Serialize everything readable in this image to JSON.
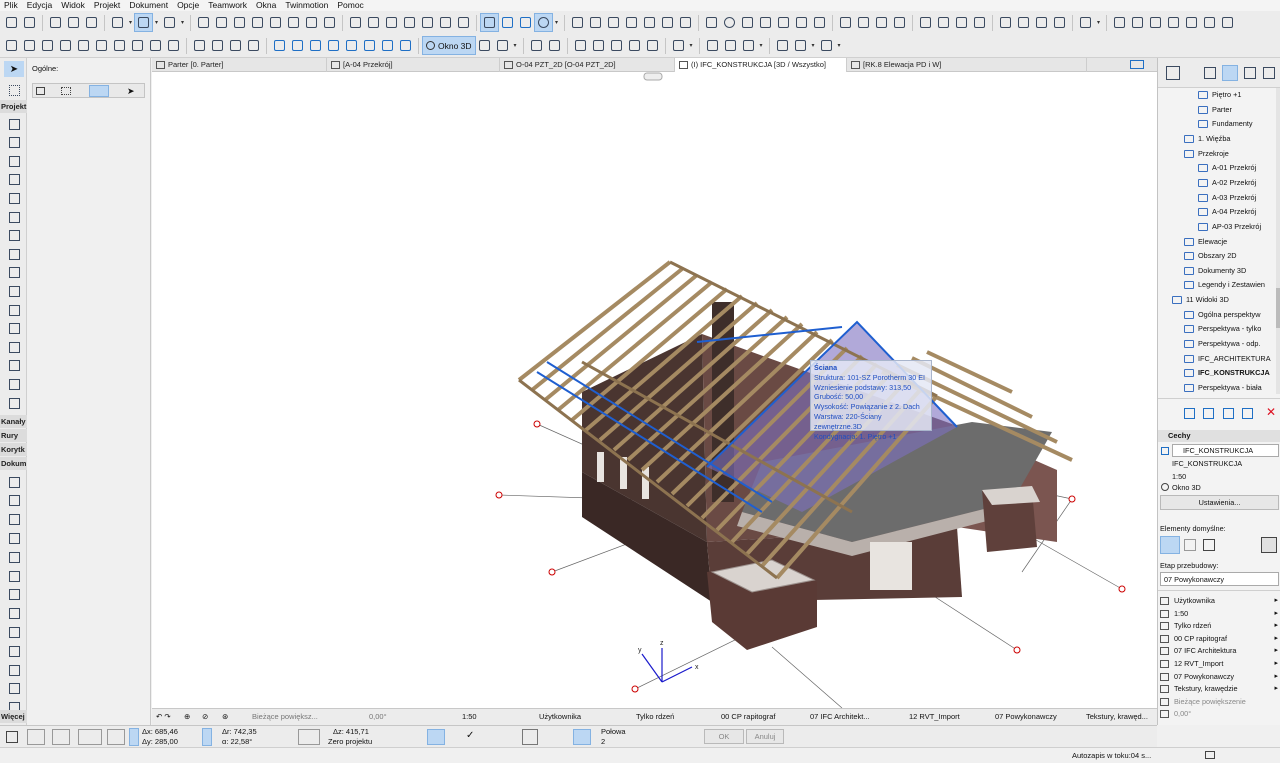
{
  "menu": [
    "Plik",
    "Edycja",
    "Widok",
    "Projekt",
    "Dokument",
    "Opcje",
    "Teamwork",
    "Okna",
    "Twinmotion",
    "Pomoc"
  ],
  "toolbar": {
    "okno3d": "Okno 3D"
  },
  "infobox": {
    "label": "Ogólne:"
  },
  "left_sections": {
    "projekt": "Projekt",
    "kanaly": "Kanały",
    "rury": "Rury",
    "korytka": "Korytk",
    "dokum": "Dokum",
    "wiecej": "Więcej"
  },
  "tabs": [
    "Parter [0. Parter]",
    "[A-04 Przekrój]",
    "O-04 PZT_2D [O-04 PZT_2D]",
    "(I) IFC_KONSTRUKCJA [3D / Wszystko]",
    "[RK.8 Elewacja PD i W]"
  ],
  "tooltip": {
    "title": "Ściana",
    "lines": [
      "Struktura: 101-SZ Porotherm 30 EI",
      "Wzniesienie podstawy: 313,50",
      "Grubość: 50,00",
      "Wysokość: Powiązanie z 2. Dach",
      "Warstwa: 220-Ściany zewnętrzne.3D",
      "Kondygnacja: 1. Piętro +1"
    ]
  },
  "axes": {
    "z": "z",
    "y": "y",
    "x": "x"
  },
  "navbar": {
    "zoom": "Bieżące powiększ...",
    "angle": "0,00°",
    "scale": "1:50",
    "user": "Użytkownika",
    "rdzen": "Tylko rdzeń",
    "pen": "00 CP rapitograf",
    "ifc": "07 IFC Architekt...",
    "rvt": "12 RVT_Import",
    "etap": "07 Powykonawczy",
    "tekstury": "Tekstury, krawęd..."
  },
  "coords": {
    "dx": "Δx: 685,46",
    "dy": "Δy: 285,00",
    "dr": "Δr: 742,35",
    "da": "α: 22,58°",
    "dz": "Δz: 415,71",
    "zero": "Zero projektu",
    "polowa": "Połowa",
    "polowa_n": "2",
    "ok": "OK",
    "anuluj": "Anuluj"
  },
  "statusbar": {
    "autosave": "Autozapis w toku:04 s..."
  },
  "navigator": [
    {
      "label": "Piętro +1",
      "indent": 2
    },
    {
      "label": "Parter",
      "indent": 2
    },
    {
      "label": "Fundamenty",
      "indent": 2
    },
    {
      "label": "1. Więźba",
      "indent": 1
    },
    {
      "label": "Przekroje",
      "indent": 1,
      "open": true
    },
    {
      "label": "A-01 Przekrój",
      "indent": 2
    },
    {
      "label": "A-02 Przekrój",
      "indent": 2
    },
    {
      "label": "A-03 Przekrój",
      "indent": 2
    },
    {
      "label": "A-04 Przekrój",
      "indent": 2
    },
    {
      "label": "AP-03 Przekrój",
      "indent": 2
    },
    {
      "label": "Elewacje",
      "indent": 1
    },
    {
      "label": "Obszary 2D",
      "indent": 1
    },
    {
      "label": "Dokumenty 3D",
      "indent": 1
    },
    {
      "label": "Legendy i Zestawien",
      "indent": 1
    },
    {
      "label": "11 Widoki 3D",
      "indent": 0,
      "open": true
    },
    {
      "label": "Ogólna perspektyw",
      "indent": 1
    },
    {
      "label": "Perspektywa - tylko",
      "indent": 1
    },
    {
      "label": "Perspektywa - odp.",
      "indent": 1
    },
    {
      "label": "IFC_ARCHITEKTURA",
      "indent": 1
    },
    {
      "label": "IFC_KONSTRUKCJA",
      "indent": 1,
      "bold": true
    },
    {
      "label": "Perspektywa - biała",
      "indent": 1
    }
  ],
  "cechy": {
    "header": "Cechy",
    "name": "IFC_KONSTRUKCJA",
    "name2": "IFC_KONSTRUKCJA",
    "scale": "1:50",
    "mode": "Okno 3D",
    "settings": "Ustawienia...",
    "defaults": "Elementy domyślne:",
    "etap_label": "Etap przebudowy:",
    "etap_value": "07 Powykonawczy"
  },
  "props": [
    "Użytkownika",
    "1:50",
    "Tylko rdzeń",
    "00 CP rapitograf",
    "07 IFC Architektura",
    "12 RVT_Import",
    "07 Powykonawczy",
    "Tekstury, krawędzie",
    "Bieżące powiększenie",
    "0,00°"
  ]
}
